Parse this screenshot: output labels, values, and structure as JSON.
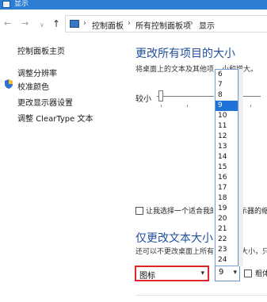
{
  "window": {
    "title": "显示"
  },
  "nav": {
    "back_glyph": "←",
    "forward_glyph": "→",
    "recent_glyph": "∨",
    "up_glyph": "↑",
    "breadcrumb_sep": "›",
    "breadcrumbs": [
      "控制面板",
      "所有控制面板项",
      "显示"
    ]
  },
  "sidebar": {
    "items": [
      "控制面板主页",
      "调整分辨率",
      "校准颜色",
      "更改显示器设置",
      "调整 ClearType 文本"
    ]
  },
  "section1": {
    "title": "更改所有项目的大小",
    "desc_left": "将桌面上的文本及其他项",
    "desc_right": "小和增大。",
    "slider_label": "较小",
    "checkbox_left": "让我选择一个适合我的",
    "checkbox_right": "示器的缩"
  },
  "section2": {
    "title": "仅更改文本大小",
    "desc_left": "还可以不更改桌面上所有",
    "desc_right": "大小，只",
    "item_select_value": "图标",
    "size_select_value": "9",
    "bold_label": "粗体"
  },
  "font_size_options": [
    "6",
    "7",
    "8",
    "9",
    "10",
    "11",
    "12",
    "13",
    "14",
    "15",
    "16",
    "17",
    "18",
    "19",
    "20",
    "21",
    "22",
    "23",
    "24"
  ],
  "selected_size_index": 3,
  "colors": {
    "titlebar": "#2b7cd3",
    "heading": "#1f4e9c",
    "selection": "#1e72d8",
    "highlight_border": "#e0242a"
  }
}
